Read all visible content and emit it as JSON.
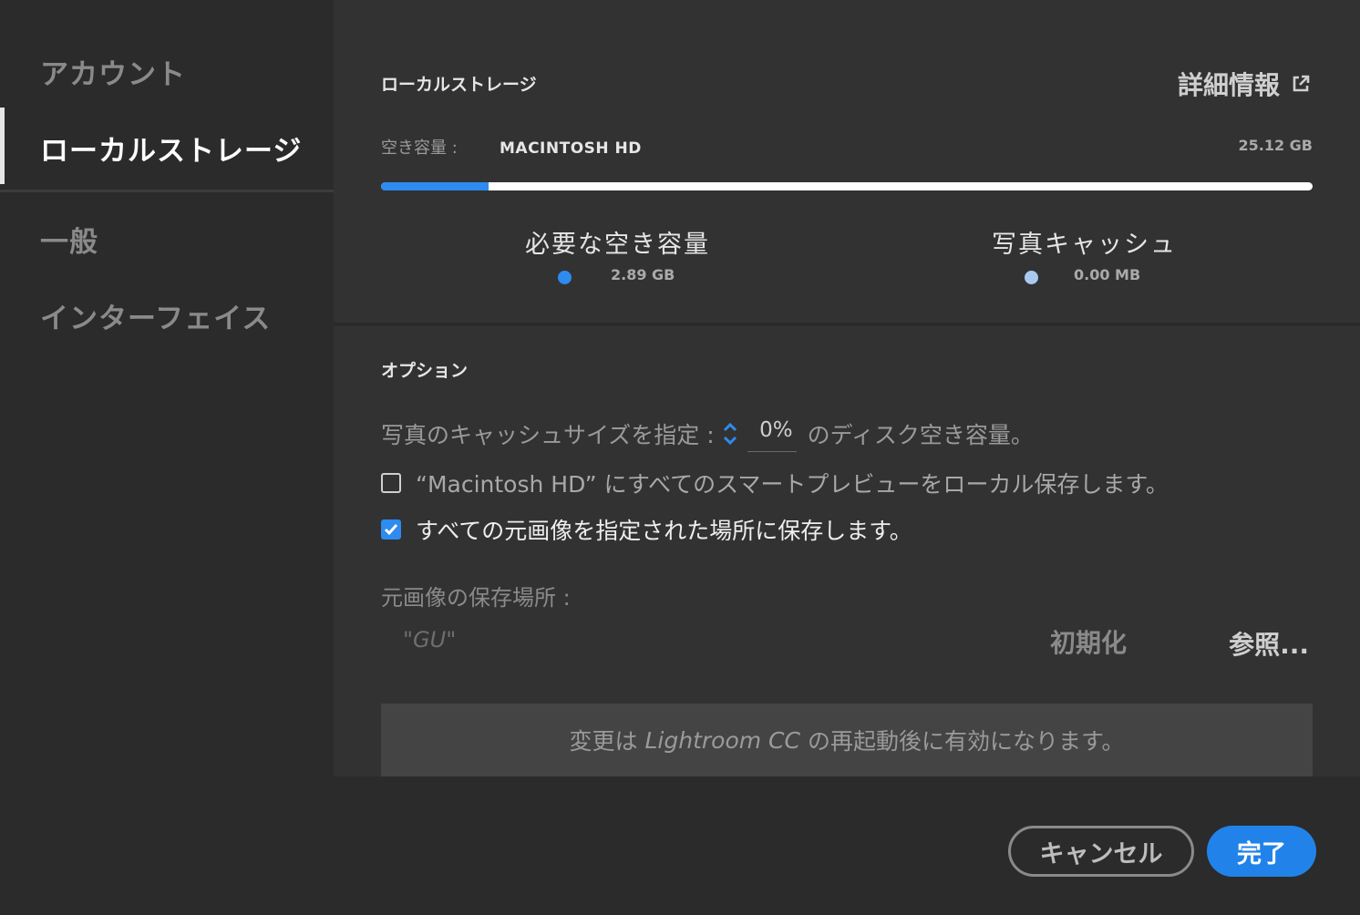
{
  "sidebar": {
    "items": [
      {
        "label": "アカウント"
      },
      {
        "label": "ローカルストレージ"
      },
      {
        "label": "一般"
      },
      {
        "label": "インターフェイス"
      }
    ],
    "active_index": 1
  },
  "storage": {
    "title": "ローカルストレージ",
    "details_link": "詳細情報",
    "free_space_label": "空き容量 :",
    "disk_name": "MACINTOSH HD",
    "disk_free": "25.12 GB",
    "usage_fraction": 0.115,
    "legend": [
      {
        "title": "必要な空き容量",
        "value": "2.89 GB",
        "color": "#2e8bef"
      },
      {
        "title": "写真キャッシュ",
        "value": "0.00 MB",
        "color": "#a9c9ee"
      }
    ]
  },
  "options": {
    "title": "オプション",
    "cache_size_prefix": "写真のキャッシュサイズを指定 :",
    "cache_size_value": "0%",
    "cache_size_suffix": "のディスク空き容量。",
    "smart_preview_label": "“Macintosh HD” にすべてのスマートプレビューをローカル保存します。",
    "smart_preview_checked": false,
    "store_originals_label": "すべての元画像を指定された場所に保存します。",
    "store_originals_checked": true,
    "location_label": "元画像の保存場所 :",
    "location_path": "\"GU\"",
    "reset_label": "初期化",
    "browse_label": "参照..."
  },
  "notice": {
    "prefix": "変更は",
    "app": "Lightroom CC",
    "suffix": "の再起動後に有効になります。"
  },
  "footer": {
    "cancel_label": "キャンセル",
    "done_label": "完了"
  },
  "colors": {
    "accent": "#2e8bef",
    "background": "#2b2b2b",
    "panel": "#323232"
  }
}
